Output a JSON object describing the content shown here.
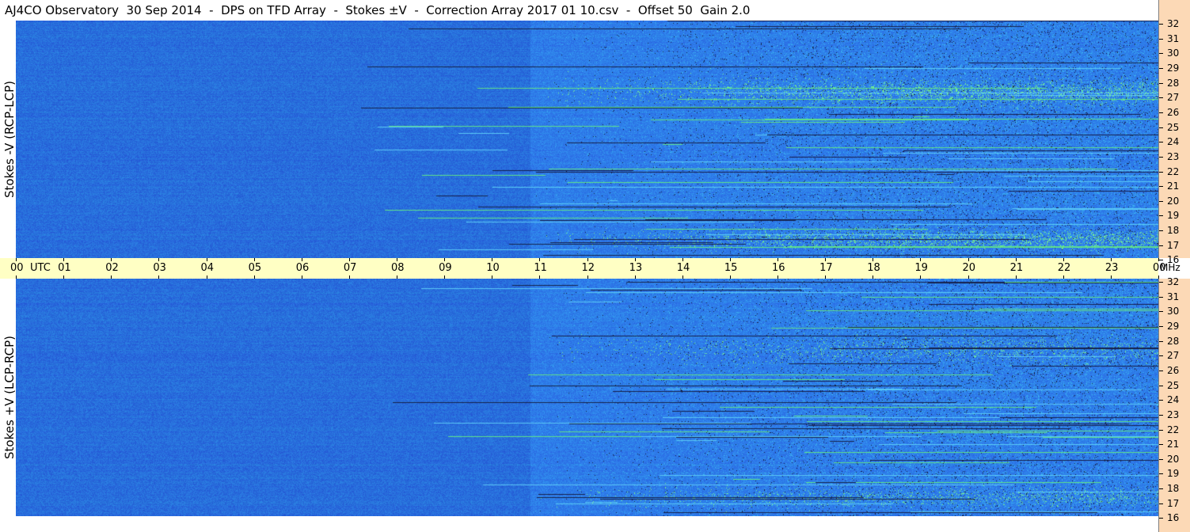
{
  "title": "AJ4CO Observatory  30 Sep 2014  -  DPS on TFD Array  -  Stokes ±V  -  Correction Array 2017 01 10.csv  -  Offset 50  Gain 2.0",
  "panels": [
    {
      "ylabel": "Stokes -V (RCP-LCP)"
    },
    {
      "ylabel": "Stokes +V (LCP-RCP)"
    }
  ],
  "utc_axis": {
    "unit_label": "UTC",
    "ticks": [
      "00",
      "01",
      "02",
      "03",
      "04",
      "05",
      "06",
      "07",
      "08",
      "09",
      "10",
      "11",
      "12",
      "13",
      "14",
      "15",
      "16",
      "17",
      "18",
      "19",
      "20",
      "21",
      "22",
      "23",
      "00"
    ]
  },
  "freq_axis": {
    "unit_label": "MHz",
    "ticks": [
      "32",
      "31",
      "30",
      "29",
      "28",
      "27",
      "26",
      "25",
      "24",
      "23",
      "22",
      "21",
      "20",
      "19",
      "18",
      "17",
      "16"
    ]
  },
  "chart_data": {
    "type": "heatmap",
    "title": "AJ4CO Observatory  30 Sep 2014  -  DPS on TFD Array  -  Stokes ±V  -  Correction Array 2017 01 10.csv  -  Offset 50  Gain 2.0",
    "x": {
      "label": "UTC",
      "range": [
        0,
        24
      ],
      "tick_labels": [
        "00",
        "01",
        "02",
        "03",
        "04",
        "05",
        "06",
        "07",
        "08",
        "09",
        "10",
        "11",
        "12",
        "13",
        "14",
        "15",
        "16",
        "17",
        "18",
        "19",
        "20",
        "21",
        "22",
        "23",
        "00"
      ]
    },
    "y": {
      "label": "MHz",
      "range": [
        16,
        32
      ],
      "tick_labels": [
        "32",
        "31",
        "30",
        "29",
        "28",
        "27",
        "26",
        "25",
        "24",
        "23",
        "22",
        "21",
        "20",
        "19",
        "18",
        "17",
        "16"
      ]
    },
    "series": [
      {
        "name": "Stokes -V (RCP-LCP)"
      },
      {
        "name": "Stokes +V (LCP-RCP)"
      }
    ],
    "colors": {
      "background": "#2e7de9",
      "deep": "#1e5fd0",
      "bright": "#3aa8f0",
      "hot": "#7ff07a",
      "dark": "#1a1a40",
      "freq_scale": "#fcd9b6",
      "time_scale": "#ffffc4"
    }
  }
}
